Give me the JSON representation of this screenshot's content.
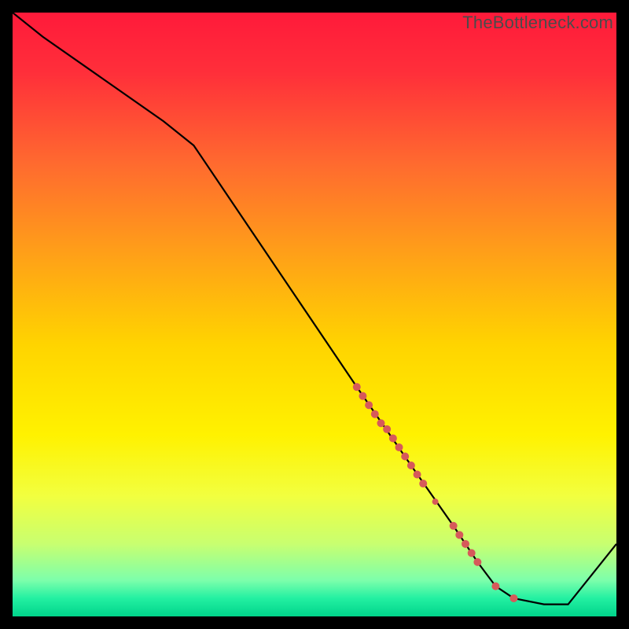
{
  "watermark": "TheBottleneck.com",
  "chart_data": {
    "type": "line",
    "title": "",
    "xlabel": "",
    "ylabel": "",
    "xlim": [
      0,
      100
    ],
    "ylim": [
      0,
      100
    ],
    "grid": false,
    "series": [
      {
        "name": "curve",
        "x": [
          0,
          5,
          25,
          30,
          57,
          66,
          73,
          77,
          80,
          83,
          88,
          92,
          100
        ],
        "y": [
          100,
          96,
          82,
          78,
          38,
          25,
          15,
          9,
          5,
          3,
          2,
          2,
          12
        ]
      }
    ],
    "scatter": {
      "name": "highlight-points",
      "color": "#d65a5a",
      "points": [
        {
          "x": 57,
          "y": 38,
          "r": 5
        },
        {
          "x": 58,
          "y": 36.5,
          "r": 5
        },
        {
          "x": 59,
          "y": 35,
          "r": 5
        },
        {
          "x": 60,
          "y": 33.5,
          "r": 5
        },
        {
          "x": 61,
          "y": 32,
          "r": 5
        },
        {
          "x": 62,
          "y": 31,
          "r": 5
        },
        {
          "x": 63,
          "y": 29.5,
          "r": 5
        },
        {
          "x": 64,
          "y": 28,
          "r": 5
        },
        {
          "x": 65,
          "y": 26.5,
          "r": 5
        },
        {
          "x": 66,
          "y": 25,
          "r": 5
        },
        {
          "x": 67,
          "y": 23.5,
          "r": 5
        },
        {
          "x": 68,
          "y": 22,
          "r": 5
        },
        {
          "x": 70,
          "y": 19,
          "r": 4
        },
        {
          "x": 73,
          "y": 15,
          "r": 5
        },
        {
          "x": 74,
          "y": 13.5,
          "r": 5
        },
        {
          "x": 75,
          "y": 12,
          "r": 5
        },
        {
          "x": 76,
          "y": 10.5,
          "r": 5
        },
        {
          "x": 77,
          "y": 9,
          "r": 5
        },
        {
          "x": 80,
          "y": 5,
          "r": 5
        },
        {
          "x": 83,
          "y": 3,
          "r": 5
        }
      ]
    },
    "background_gradient": {
      "stops": [
        {
          "offset": 0.0,
          "color": "#ff1a3a"
        },
        {
          "offset": 0.1,
          "color": "#ff2f3a"
        },
        {
          "offset": 0.25,
          "color": "#ff6a2f"
        },
        {
          "offset": 0.4,
          "color": "#ffa018"
        },
        {
          "offset": 0.55,
          "color": "#ffd400"
        },
        {
          "offset": 0.7,
          "color": "#fff200"
        },
        {
          "offset": 0.8,
          "color": "#f2ff3f"
        },
        {
          "offset": 0.88,
          "color": "#c8ff70"
        },
        {
          "offset": 0.94,
          "color": "#7dffab"
        },
        {
          "offset": 0.97,
          "color": "#23f0a2"
        },
        {
          "offset": 1.0,
          "color": "#00d48a"
        }
      ]
    }
  }
}
